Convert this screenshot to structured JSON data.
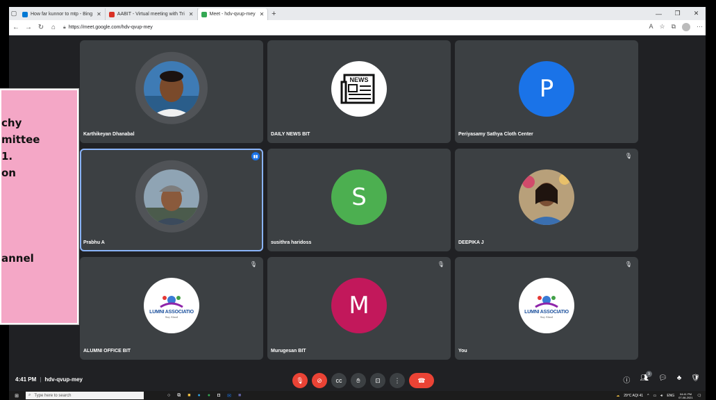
{
  "browser": {
    "tabs": [
      {
        "label": "How far kunnor to mtp - Bing",
        "active": false,
        "color": "#0078d4"
      },
      {
        "label": "AABIT - Virtual meeting with Tri",
        "active": false,
        "color": "#d93025"
      },
      {
        "label": "Meet - hdv-qvup-mey",
        "active": true,
        "color": "#34a853"
      }
    ],
    "new_tab": "+",
    "url": "https://meet.google.com/hdv-qvup-mey"
  },
  "meeting": {
    "participants": [
      {
        "name": "Karthikeyan Dhanabal",
        "type": "photo"
      },
      {
        "name": "DAILY NEWS BIT",
        "type": "news"
      },
      {
        "name": "Periyasamy Sathya Cloth Center",
        "type": "letter",
        "letter": "P",
        "color": "#1a73e8"
      },
      {
        "name": "Prabhu A",
        "type": "photo"
      },
      {
        "name": "susithra haridoss",
        "type": "letter",
        "letter": "S",
        "color": "#4caf50"
      },
      {
        "name": "DEEPIKA J",
        "type": "photo"
      },
      {
        "name": "ALUMNI OFFICE BIT",
        "type": "logo"
      },
      {
        "name": "Murugesan BIT",
        "type": "letter",
        "letter": "M",
        "color": "#c2185b"
      },
      {
        "name": "You",
        "type": "logo"
      }
    ],
    "logo_title": "LUMNI ASSOCIATIO",
    "logo_tagline": "Stay Ahead",
    "news_label": "NEWS",
    "time": "4:41 PM",
    "meeting_code": "hdv-qvup-mey",
    "participant_badge": "9"
  },
  "taskbar": {
    "search_placeholder": "Type here to search",
    "weather": "29°C AQI 41",
    "lang": "ENG",
    "clock_time": "04:41 PM",
    "clock_date": "07-08-2021"
  },
  "overlay": {
    "lines": [
      "chy",
      "mittee",
      "1.",
      "on",
      "annel"
    ]
  }
}
